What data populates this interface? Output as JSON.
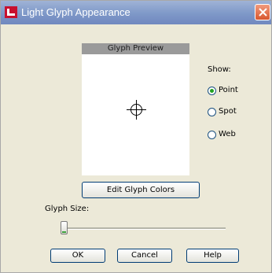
{
  "window": {
    "title": "Light Glyph Appearance",
    "icon": "app-icon",
    "close_icon": "close-icon",
    "accent": "#7e98c8"
  },
  "preview": {
    "header": "Glyph Preview",
    "glyph_icon": "crosshair-icon"
  },
  "show": {
    "label": "Show:",
    "options": [
      {
        "label": "Point",
        "selected": true
      },
      {
        "label": "Spot",
        "selected": false
      },
      {
        "label": "Web",
        "selected": false
      }
    ]
  },
  "buttons": {
    "edit_colors": "Edit Glyph Colors",
    "ok": "OK",
    "cancel": "Cancel",
    "help": "Help"
  },
  "glyph_size": {
    "label": "Glyph Size:",
    "value_fraction": 0.0
  }
}
